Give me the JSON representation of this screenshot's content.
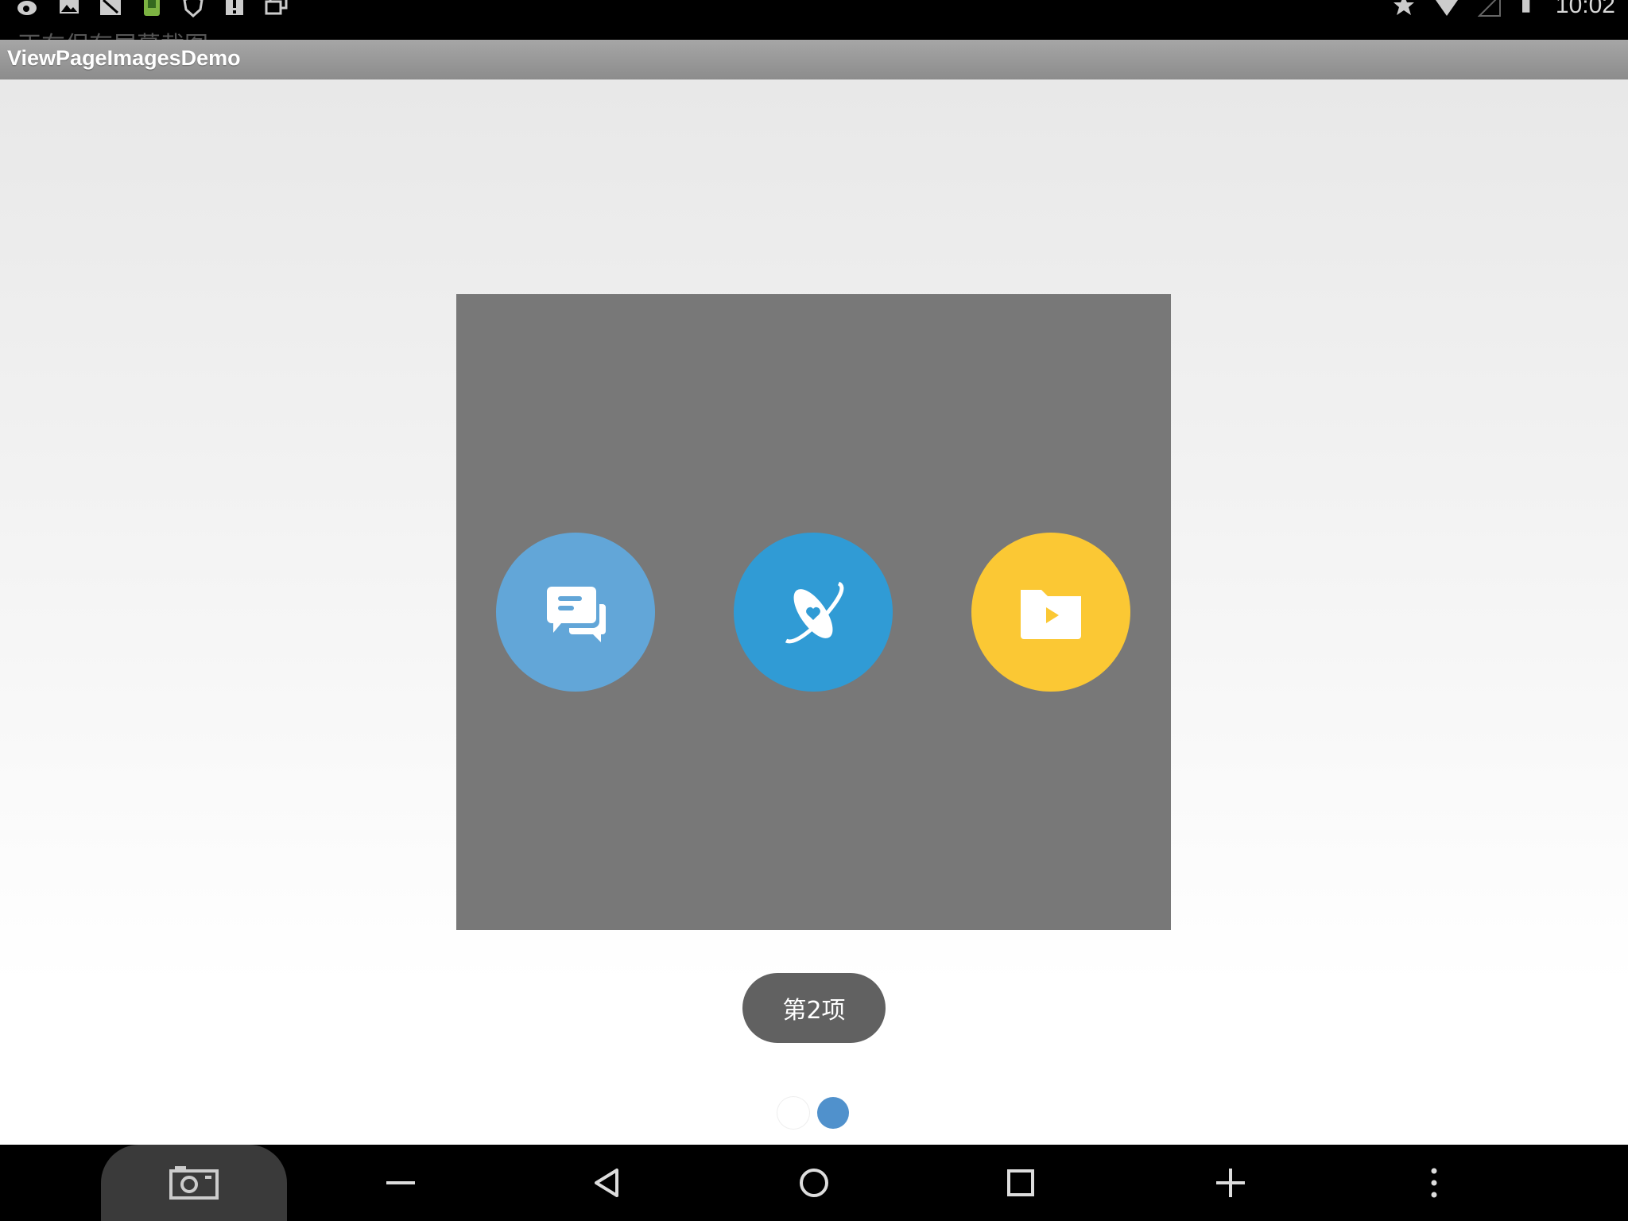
{
  "status_bar": {
    "clock": "10:02",
    "notification_peek": "正在保存屏幕截图",
    "left_icons": [
      "weibo-icon",
      "image-icon",
      "no-signal-app-icon",
      "android-icon",
      "shield-heart-icon",
      "alert-icon",
      "screens-icon"
    ],
    "right_icons": [
      "star-icon",
      "wifi-icon",
      "cellular-icon",
      "battery-icon"
    ]
  },
  "app": {
    "title": "ViewPageImagesDemo"
  },
  "pager": {
    "background": "#787878",
    "items": [
      {
        "icon": "chat-bubbles-icon",
        "color": "#62a6d8"
      },
      {
        "icon": "planet-heart-icon",
        "color": "#309bd5"
      },
      {
        "icon": "video-folder-icon",
        "color": "#fbc834"
      }
    ]
  },
  "toast": {
    "text": "第2项"
  },
  "indicator": {
    "count": 2,
    "active_index": 1,
    "active_color": "#5091cc"
  },
  "nav_bar": {
    "buttons": [
      "screenshot-icon",
      "volume-down-icon",
      "back-icon",
      "home-icon",
      "recents-icon",
      "volume-up-icon",
      "menu-icon"
    ]
  }
}
